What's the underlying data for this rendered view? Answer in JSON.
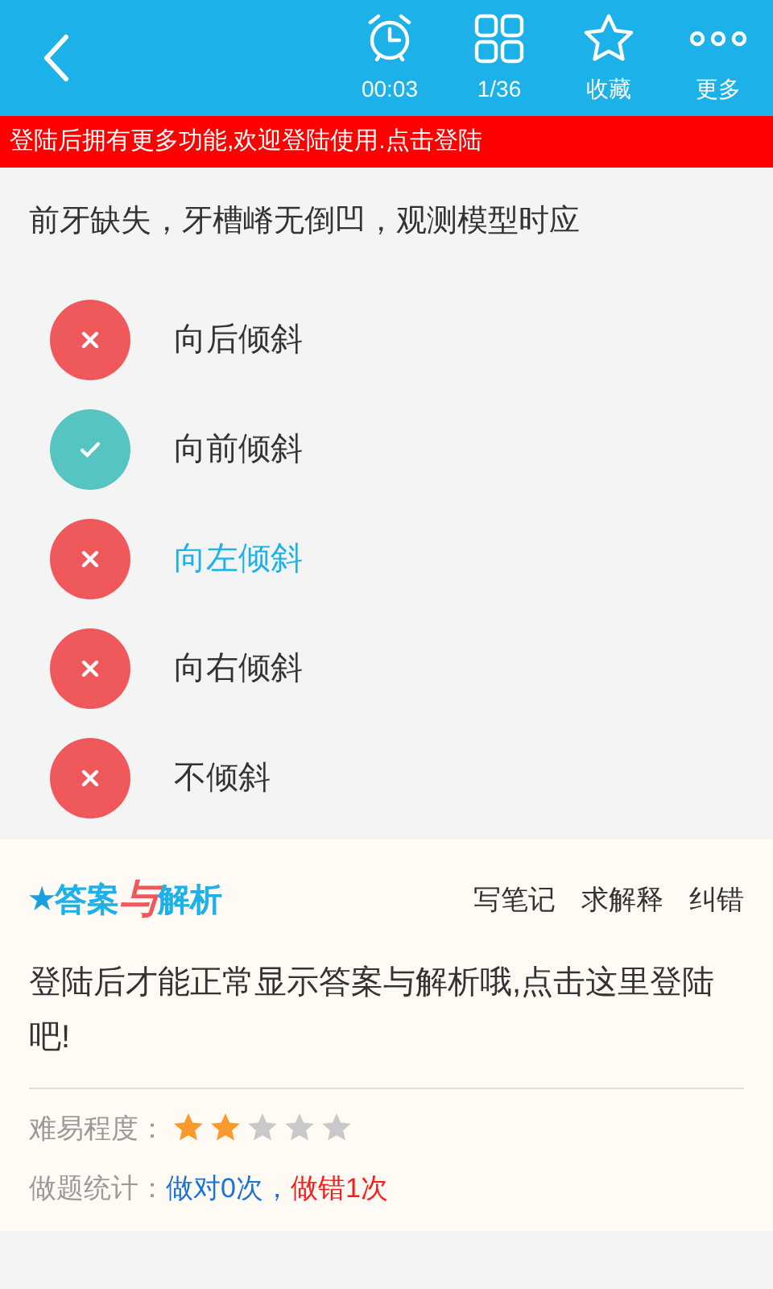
{
  "toolbar": {
    "items": [
      {
        "kind": "timer",
        "label": "00:03"
      },
      {
        "kind": "grid",
        "label": "1/36"
      },
      {
        "kind": "star",
        "label": "收藏"
      },
      {
        "kind": "more",
        "label": "更多"
      }
    ]
  },
  "banner": "登陆后拥有更多功能,欢迎登陆使用.点击登陆",
  "question": "前牙缺失，牙槽嵴无倒凹，观测模型时应",
  "options": [
    {
      "kind": "wrong",
      "label": "向后倾斜",
      "selected": false
    },
    {
      "kind": "right",
      "label": "向前倾斜",
      "selected": false
    },
    {
      "kind": "wrong",
      "label": "向左倾斜",
      "selected": true
    },
    {
      "kind": "wrong",
      "label": "向右倾斜",
      "selected": false
    },
    {
      "kind": "wrong",
      "label": "不倾斜",
      "selected": false
    }
  ],
  "analysis": {
    "logo": {
      "star": "★",
      "part1": "答案",
      "part2": "与",
      "part3": "解析"
    },
    "actions": [
      "写笔记",
      "求解释",
      "纠错"
    ],
    "message": "登陆后才能正常显示答案与解析哦,点击这里登陆吧!",
    "difficulty": {
      "label": "难易程度：",
      "stars": 2
    },
    "stats": {
      "label": "做题统计：",
      "right": "做对0次",
      "separator": "，",
      "wrong": "做错1次"
    }
  }
}
